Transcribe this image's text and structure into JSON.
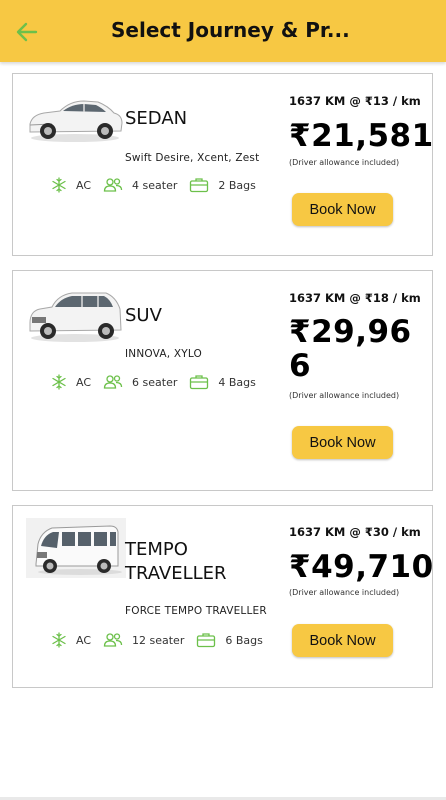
{
  "header": {
    "title": "Select Journey & Pr...",
    "back_icon": "arrow-left-icon",
    "accent_color": "#f7c843",
    "icon_color": "#6cc04a"
  },
  "vehicles": [
    {
      "name": "SEDAN",
      "models": "Swift Desire, Xcent, Zest",
      "ac_label": "AC",
      "seater": "4 seater",
      "bags": "2 Bags",
      "rate": "1637 KM @ ₹13 / km",
      "price": "₹21,581",
      "allowance": "(Driver allowance included)",
      "book_label": "Book Now"
    },
    {
      "name": "SUV",
      "models": "INNOVA, XYLO",
      "ac_label": "AC",
      "seater": "6 seater",
      "bags": "4 Bags",
      "rate": "1637 KM @ ₹18 / km",
      "price": "₹29,966",
      "allowance": "(Driver allowance included)",
      "book_label": "Book Now"
    },
    {
      "name": "TEMPO TRAVELLER",
      "models": "FORCE TEMPO TRAVELLER",
      "ac_label": "AC",
      "seater": "12 seater",
      "bags": "6 Bags",
      "rate": "1637 KM @ ₹30 / km",
      "price": "₹49,710",
      "allowance": "(Driver allowance included)",
      "book_label": "Book Now"
    }
  ]
}
